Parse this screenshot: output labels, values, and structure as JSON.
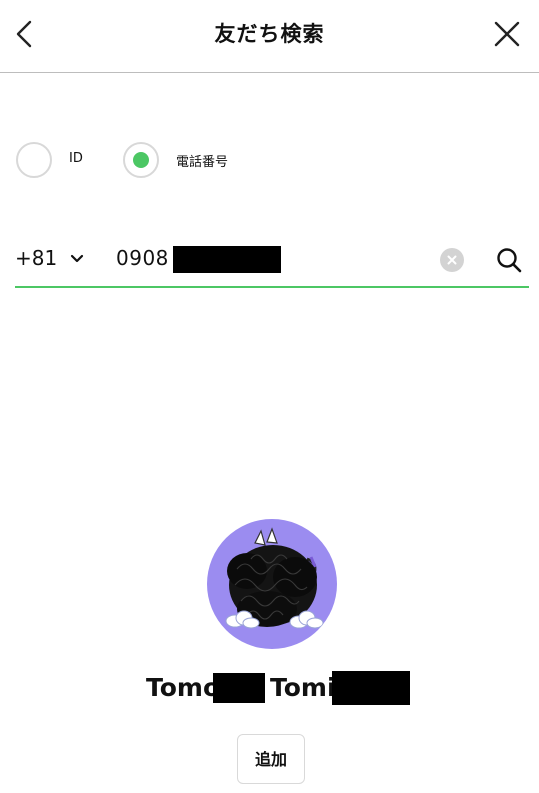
{
  "header": {
    "title": "友だち検索",
    "back_icon": "chevron-left-icon",
    "close_icon": "close-x-icon"
  },
  "search_type": {
    "options": [
      {
        "label": "ID",
        "selected": false
      },
      {
        "label": "電話番号",
        "selected": true
      }
    ]
  },
  "phone_search": {
    "country_code": "+81",
    "country_dropdown_icon": "chevron-down-icon",
    "value_visible": "0908",
    "clear_icon": "clear-circle-icon",
    "search_icon": "search-icon"
  },
  "result": {
    "name_part1": "Tomo",
    "name_part2": "Tomi",
    "add_label": "追加"
  },
  "colors": {
    "accent_green": "#4cc764",
    "avatar_bg": "#9b8cf0",
    "divider": "#bdbdbd",
    "redaction": "#000000"
  }
}
